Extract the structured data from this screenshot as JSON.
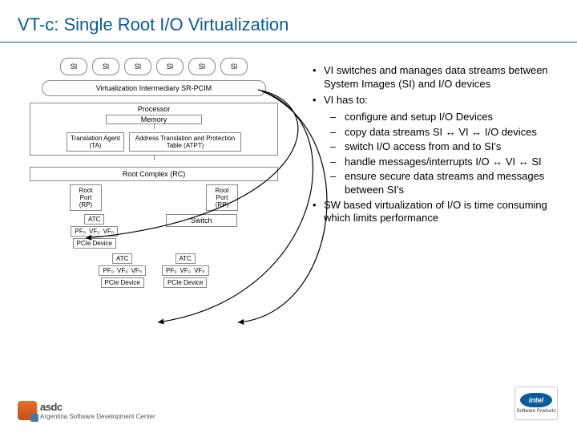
{
  "title": "VT-c: Single Root I/O Virtualization",
  "diagram": {
    "si_label": "SI",
    "vi_label": "Virtualization Intermediary   SR-PCIM",
    "processor": "Processor",
    "memory": "Memory",
    "ta": "Translation\nAgent (TA)",
    "atpt": "Address Translation and\nProtection Table (ATPT)",
    "rc": "Root Complex (RC)",
    "rp": "Root\nPort\n(RP)",
    "switch": "Switch",
    "atc": "ATC",
    "pf0": "PF₀",
    "vf0": "VF₀",
    "vfn": "VFₙ",
    "pcie": "PCIe Device"
  },
  "bullets": {
    "b1": "VI switches and manages data streams between System Images (SI) and I/O devices",
    "b2": "VI has to:",
    "b2a": "configure and setup I/O Devices",
    "b2b": "copy data streams SI ↔ VI ↔ I/O devices",
    "b2c": "switch I/O access from and to SI's",
    "b2d": "handle messages/interrupts I/O ↔ VI ↔ SI",
    "b2e": "ensure secure data streams and messages between SI's",
    "b3": "SW based virtualization of I/O is time consuming which limits performance"
  },
  "logos": {
    "asdc_name": "asdc",
    "asdc_sub": "Argentina Software\nDevelopment Center",
    "intel": "intel",
    "intel_sub": "Software\nProducts"
  }
}
